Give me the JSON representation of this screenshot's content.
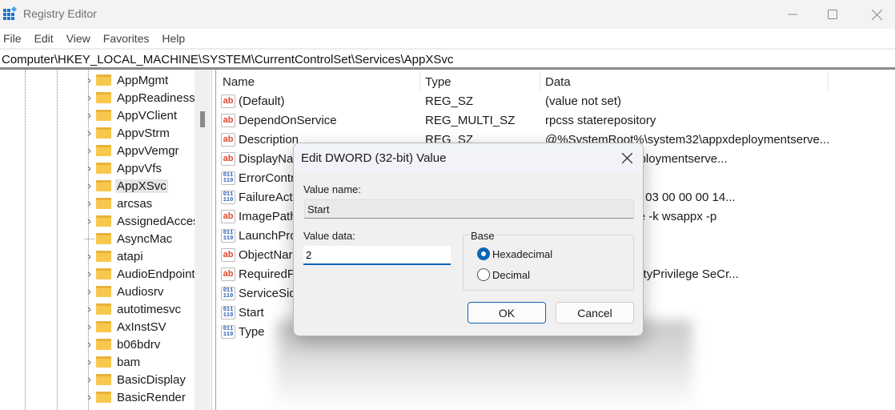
{
  "window": {
    "title": "Registry Editor",
    "controls": {
      "minimize": "minimize",
      "maximize": "maximize",
      "close": "close"
    }
  },
  "menu": [
    "File",
    "Edit",
    "View",
    "Favorites",
    "Help"
  ],
  "address": "Computer\\HKEY_LOCAL_MACHINE\\SYSTEM\\CurrentControlSet\\Services\\AppXSvc",
  "tree": {
    "items": [
      {
        "label": "AppMgmt",
        "expandable": true
      },
      {
        "label": "AppReadiness",
        "expandable": true
      },
      {
        "label": "AppVClient",
        "expandable": true
      },
      {
        "label": "AppvStrm",
        "expandable": true
      },
      {
        "label": "AppvVemgr",
        "expandable": true
      },
      {
        "label": "AppvVfs",
        "expandable": true
      },
      {
        "label": "AppXSvc",
        "expandable": true,
        "selected": true
      },
      {
        "label": "arcsas",
        "expandable": true
      },
      {
        "label": "AssignedAcces",
        "expandable": true
      },
      {
        "label": "AsyncMac",
        "expandable": false
      },
      {
        "label": "atapi",
        "expandable": true
      },
      {
        "label": "AudioEndpoint",
        "expandable": true
      },
      {
        "label": "Audiosrv",
        "expandable": true
      },
      {
        "label": "autotimesvc",
        "expandable": true
      },
      {
        "label": "AxInstSV",
        "expandable": true
      },
      {
        "label": "b06bdrv",
        "expandable": true
      },
      {
        "label": "bam",
        "expandable": true
      },
      {
        "label": "BasicDisplay",
        "expandable": true
      },
      {
        "label": "BasicRender",
        "expandable": true
      }
    ]
  },
  "list": {
    "columns": {
      "name": "Name",
      "type": "Type",
      "data": "Data"
    },
    "rows": [
      {
        "icon": "string",
        "name": "(Default)",
        "type": "REG_SZ",
        "data": "(value not set)"
      },
      {
        "icon": "string",
        "name": "DependOnService",
        "type": "REG_MULTI_SZ",
        "data": "rpcss staterepository"
      },
      {
        "icon": "string",
        "name": "Description",
        "type": "REG_SZ",
        "data": "@%SystemRoot%\\system32\\appxdeploymentserve..."
      },
      {
        "icon": "string",
        "name": "DisplayNa",
        "type": "",
        "data": "system32\\appxdeploymentserve..."
      },
      {
        "icon": "binary",
        "name": "ErrorContr",
        "type": "",
        "data": ""
      },
      {
        "icon": "binary",
        "name": "FailureActi",
        "type": "",
        "data": "00 00 00 00 00 00 03 00 00 00 14..."
      },
      {
        "icon": "string",
        "name": "ImagePath",
        "type": "",
        "data": "tem32\\svchost.exe -k wsappx -p"
      },
      {
        "icon": "binary",
        "name": "LaunchPro",
        "type": "",
        "data": ""
      },
      {
        "icon": "string",
        "name": "ObjectNar",
        "type": "",
        "data": ""
      },
      {
        "icon": "string",
        "name": "RequiredP",
        "type": "",
        "data": "ncreaseBasePriorityPrivilege SeCr..."
      },
      {
        "icon": "binary",
        "name": "ServiceSid",
        "type": "",
        "data": ""
      },
      {
        "icon": "binary",
        "name": "Start",
        "type": "",
        "data": ""
      },
      {
        "icon": "binary",
        "name": "Type",
        "type": "",
        "data": ""
      }
    ],
    "icon_text": {
      "string": "ab",
      "binary": "011\n110"
    }
  },
  "dialog": {
    "title": "Edit DWORD (32-bit) Value",
    "value_name_label": "Value name:",
    "value_name": "Start",
    "value_data_label": "Value data:",
    "value_data": "2",
    "base_label": "Base",
    "base_options": [
      {
        "label": "Hexadecimal",
        "selected": true
      },
      {
        "label": "Decimal",
        "selected": false
      }
    ],
    "ok_label": "OK",
    "cancel_label": "Cancel"
  },
  "colors": {
    "accent": "#0f64b4",
    "folder": "#f8c84e",
    "string_icon": "#e0492f",
    "binary_icon": "#2d5fb5"
  }
}
